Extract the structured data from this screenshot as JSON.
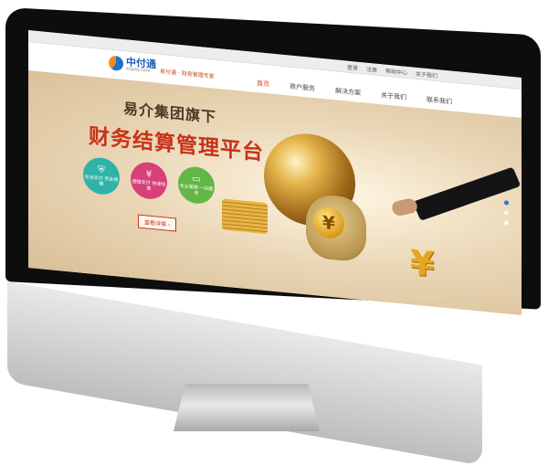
{
  "topbar": {
    "items": [
      "登录",
      "注册",
      "帮助中心",
      "关于我们"
    ]
  },
  "header": {
    "logo_name": "中付通",
    "logo_sub": "ezpay.com",
    "slogan": "易付通 · 财务管理专家",
    "nav": [
      "首页",
      "商户服务",
      "解决方案",
      "关于我们",
      "联系我们"
    ]
  },
  "hero": {
    "line1": "易介集团旗下",
    "line2": "财务结算管理平台",
    "features": [
      {
        "icon": "shield-icon",
        "glyph": "⛨",
        "text": "安全支付 资金保障",
        "color": "#2fb3a7"
      },
      {
        "icon": "yen-icon",
        "glyph": "¥",
        "text": "便捷支付 快速结算",
        "color": "#d8407a"
      },
      {
        "icon": "monitor-icon",
        "glyph": "▭",
        "text": "专业管理 一站服务",
        "color": "#62b646"
      }
    ],
    "detail_button": "查看详情 ›",
    "yen_symbol": "¥"
  },
  "carousel": {
    "count": 3,
    "active": 1
  },
  "device": {
    "apple_logo": ""
  }
}
